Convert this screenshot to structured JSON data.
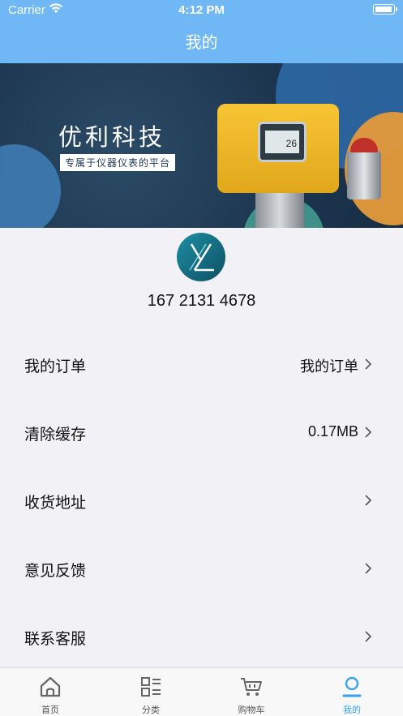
{
  "status_bar": {
    "carrier": "Carrier",
    "time": "4:12 PM"
  },
  "nav": {
    "title": "我的"
  },
  "banner": {
    "brand": "优利科技",
    "tagline": "专属于仪器仪表的平台",
    "device_reading": "26"
  },
  "profile": {
    "phone": "167 2131 4678"
  },
  "menu": [
    {
      "label": "我的订单",
      "value": "我的订单"
    },
    {
      "label": "清除缓存",
      "value": "0.17MB"
    },
    {
      "label": "收货地址",
      "value": ""
    },
    {
      "label": "意见反馈",
      "value": ""
    },
    {
      "label": "联系客服",
      "value": ""
    }
  ],
  "tabs": [
    {
      "label": "首页",
      "icon": "home-icon"
    },
    {
      "label": "分类",
      "icon": "category-icon"
    },
    {
      "label": "购物车",
      "icon": "cart-icon"
    },
    {
      "label": "我的",
      "icon": "profile-icon",
      "active": true
    }
  ],
  "colors": {
    "header": "#6fb8f5",
    "tab_active": "#36a2f0",
    "background": "#f2f2f6"
  }
}
